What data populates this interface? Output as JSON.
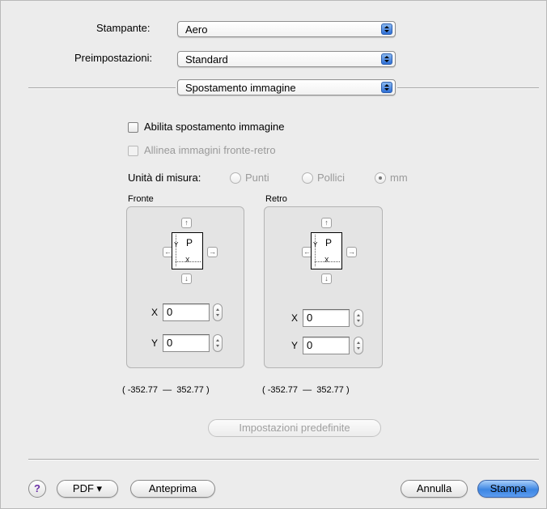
{
  "printer": {
    "label": "Stampante:",
    "value": "Aero"
  },
  "presets": {
    "label": "Preimpostazioni:",
    "value": "Standard"
  },
  "panel": {
    "value": "Spostamento immagine"
  },
  "options": {
    "enable_shift": "Abilita spostamento immagine",
    "align_duplex": "Allinea immagini fronte-retro"
  },
  "units": {
    "label": "Unità di misura:",
    "points": "Punti",
    "inches": "Pollici",
    "mm": "mm",
    "selected": "mm"
  },
  "front": {
    "title": "Fronte",
    "page_letter": "P",
    "axis_y": "Y",
    "axis_x": "X",
    "x_label": "X",
    "x_value": "0",
    "y_label": "Y",
    "y_value": "0",
    "range": "( -352.77  —  352.77 )"
  },
  "back": {
    "title": "Retro",
    "page_letter": "P",
    "axis_y": "Y",
    "axis_x": "X",
    "x_label": "X",
    "x_value": "0",
    "y_label": "Y",
    "y_value": "0",
    "range": "( -352.77  —  352.77 )"
  },
  "defaults_button": "Impostazioni predefinite",
  "footer": {
    "help": "?",
    "pdf": "PDF ▾",
    "preview": "Anteprima",
    "cancel": "Annulla",
    "print": "Stampa"
  },
  "colors": {
    "primary_button": "#3d86e2",
    "help_icon": "#6a2fa6"
  }
}
